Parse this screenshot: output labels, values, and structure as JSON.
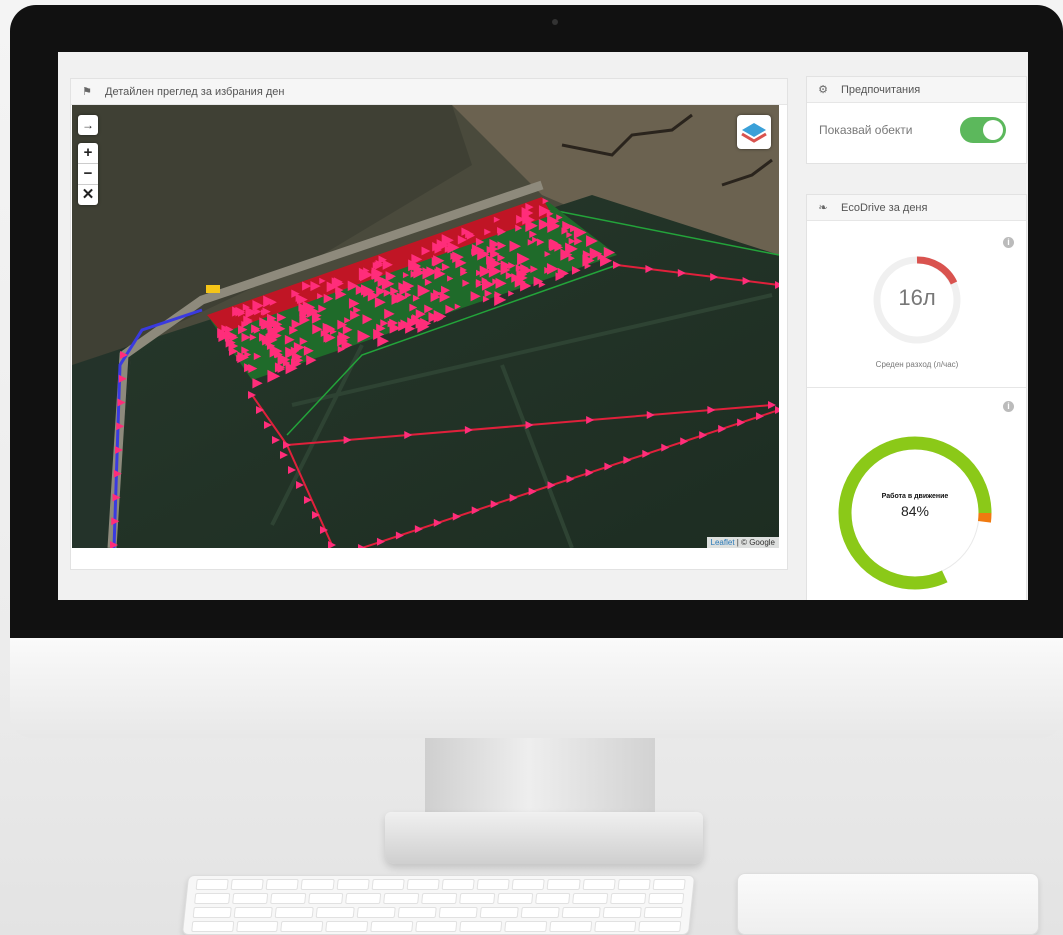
{
  "map_panel": {
    "title": "Детайлен преглед за избрания ден",
    "attribution_leaflet": "Leaflet",
    "attribution_rest": " | © Google"
  },
  "map_controls": {
    "fullscreen": "→",
    "zoom_in": "+",
    "zoom_out": "−",
    "close": "✕"
  },
  "preferences": {
    "title": "Предпочитания",
    "show_objects_label": "Показвай обекти",
    "show_objects_on": true
  },
  "ecodrive": {
    "title": "EcoDrive за деня",
    "fuel_value": "16л",
    "fuel_label": "Среден разход (л/час)",
    "motion_label": "Работа в движение",
    "motion_value": "84%",
    "motion_percent": 84
  },
  "colors": {
    "accent_green": "#5cb85c",
    "donut_green": "#8bc918",
    "donut_orange": "#f07a10",
    "gauge_red": "#d9534f",
    "track_pink": "#ff2d7a",
    "track_blue": "#3a3ae0"
  },
  "icons": {
    "map_panel": "map-icon",
    "preferences": "gear-icon",
    "ecodrive": "leaf-icon",
    "info": "info-icon",
    "layers": "layers-icon"
  }
}
